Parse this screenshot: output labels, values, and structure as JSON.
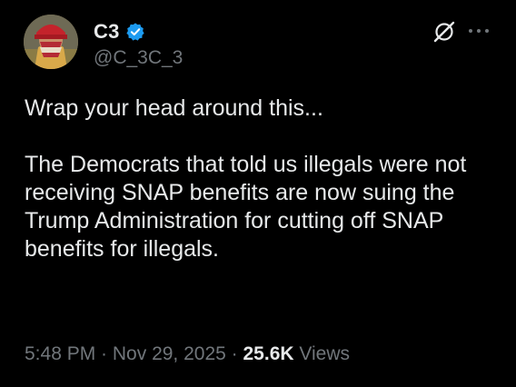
{
  "author": {
    "display_name": "C3",
    "handle": "@C_3C_3",
    "verified": true,
    "verified_color": "#1d9bf0"
  },
  "icons": {
    "avatar": "avatar-photo",
    "verified": "verified-badge-icon",
    "grok": "grok-icon",
    "more": "more-options-icon"
  },
  "tweet": {
    "line1": "Wrap your head around this...",
    "line2": "The Democrats that told us illegals were not receiving SNAP benefits are now suing the Trump Administration for cutting off SNAP benefits for illegals."
  },
  "meta": {
    "time": "5:48 PM",
    "separator": " · ",
    "date": "Nov 29, 2025",
    "views_count": "25.6K",
    "views_label": "Views"
  },
  "colors": {
    "background": "#000000",
    "text_primary": "#e7e9ea",
    "text_secondary": "#71767b"
  }
}
